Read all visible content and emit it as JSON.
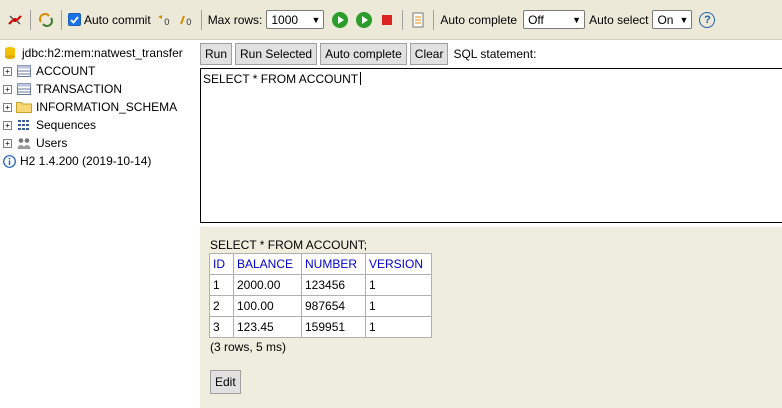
{
  "toolbar": {
    "auto_commit_label": "Auto commit",
    "max_rows_label": "Max rows:",
    "max_rows_value": "1000",
    "auto_complete_label": "Auto complete",
    "auto_complete_value": "Off",
    "auto_select_label": "Auto select",
    "auto_select_value": "On",
    "help_label": "?"
  },
  "tree": {
    "connection": "jdbc:h2:mem:natwest_transfer",
    "items": [
      {
        "label": "ACCOUNT"
      },
      {
        "label": "TRANSACTION"
      },
      {
        "label": "INFORMATION_SCHEMA"
      },
      {
        "label": "Sequences"
      },
      {
        "label": "Users"
      }
    ],
    "version": "H2 1.4.200 (2019-10-14)"
  },
  "commands": {
    "run": "Run",
    "run_selected": "Run Selected",
    "auto_complete": "Auto complete",
    "clear": "Clear",
    "sql_label": "SQL statement:"
  },
  "editor": {
    "text": "SELECT * FROM ACCOUNT"
  },
  "result": {
    "query": "SELECT * FROM ACCOUNT;",
    "columns": [
      "ID",
      "BALANCE",
      "NUMBER",
      "VERSION"
    ],
    "rows": [
      [
        "1",
        "2000.00",
        "123456",
        "1"
      ],
      [
        "2",
        "100.00",
        "987654",
        "1"
      ],
      [
        "3",
        "123.45",
        "159951",
        "1"
      ]
    ],
    "info": "(3 rows, 5 ms)",
    "edit_label": "Edit"
  },
  "colors": {
    "panel_bg": "#efedde",
    "toolbar_bg": "#ece9d8",
    "header_text": "#0000cc"
  }
}
